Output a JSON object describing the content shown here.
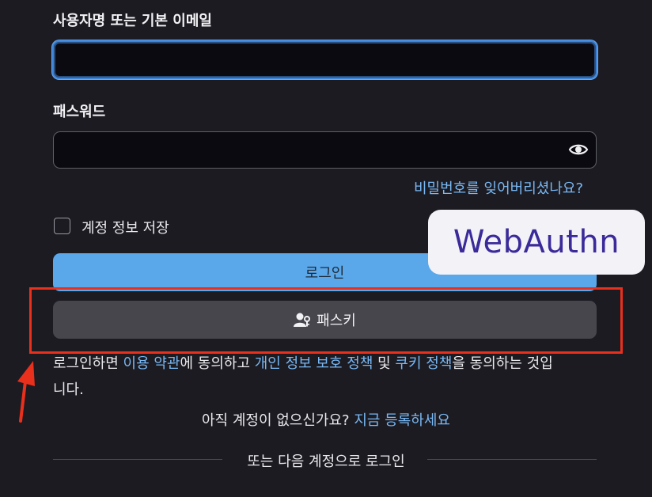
{
  "form": {
    "username_label": "사용자명 또는 기본 이메일",
    "username_value": "",
    "password_label": "패스워드",
    "password_value": "",
    "forgot_password": "비밀번호를 잊어버리셨나요?",
    "remember_label": "계정 정보 저장",
    "login_button": "로그인",
    "passkey_button": "패스키"
  },
  "terms": {
    "prefix": "로그인하면 ",
    "terms_link": "이용 약관",
    "mid1": "에 동의하고 ",
    "privacy_link": "개인 정보 보호 정책",
    "mid2": " 및 ",
    "cookie_link": "쿠키 정책",
    "suffix1": "을 동의하는 것입",
    "suffix2": "니다."
  },
  "signup": {
    "question": "아직 계정이 없으신가요?",
    "link": "지금 등록하세요"
  },
  "alt_login": "또는 다음 계정으로 로그인",
  "overlay": {
    "webauthn": "WebAuthn"
  },
  "icons": {
    "eye": "eye-icon",
    "passkey": "person-key-icon",
    "arrow": "arrow-up-icon"
  },
  "colors": {
    "accent": "#5aa7ea",
    "link": "#79b8f3",
    "highlight": "#e8301c",
    "webauthn_text": "#3a2a9a"
  }
}
